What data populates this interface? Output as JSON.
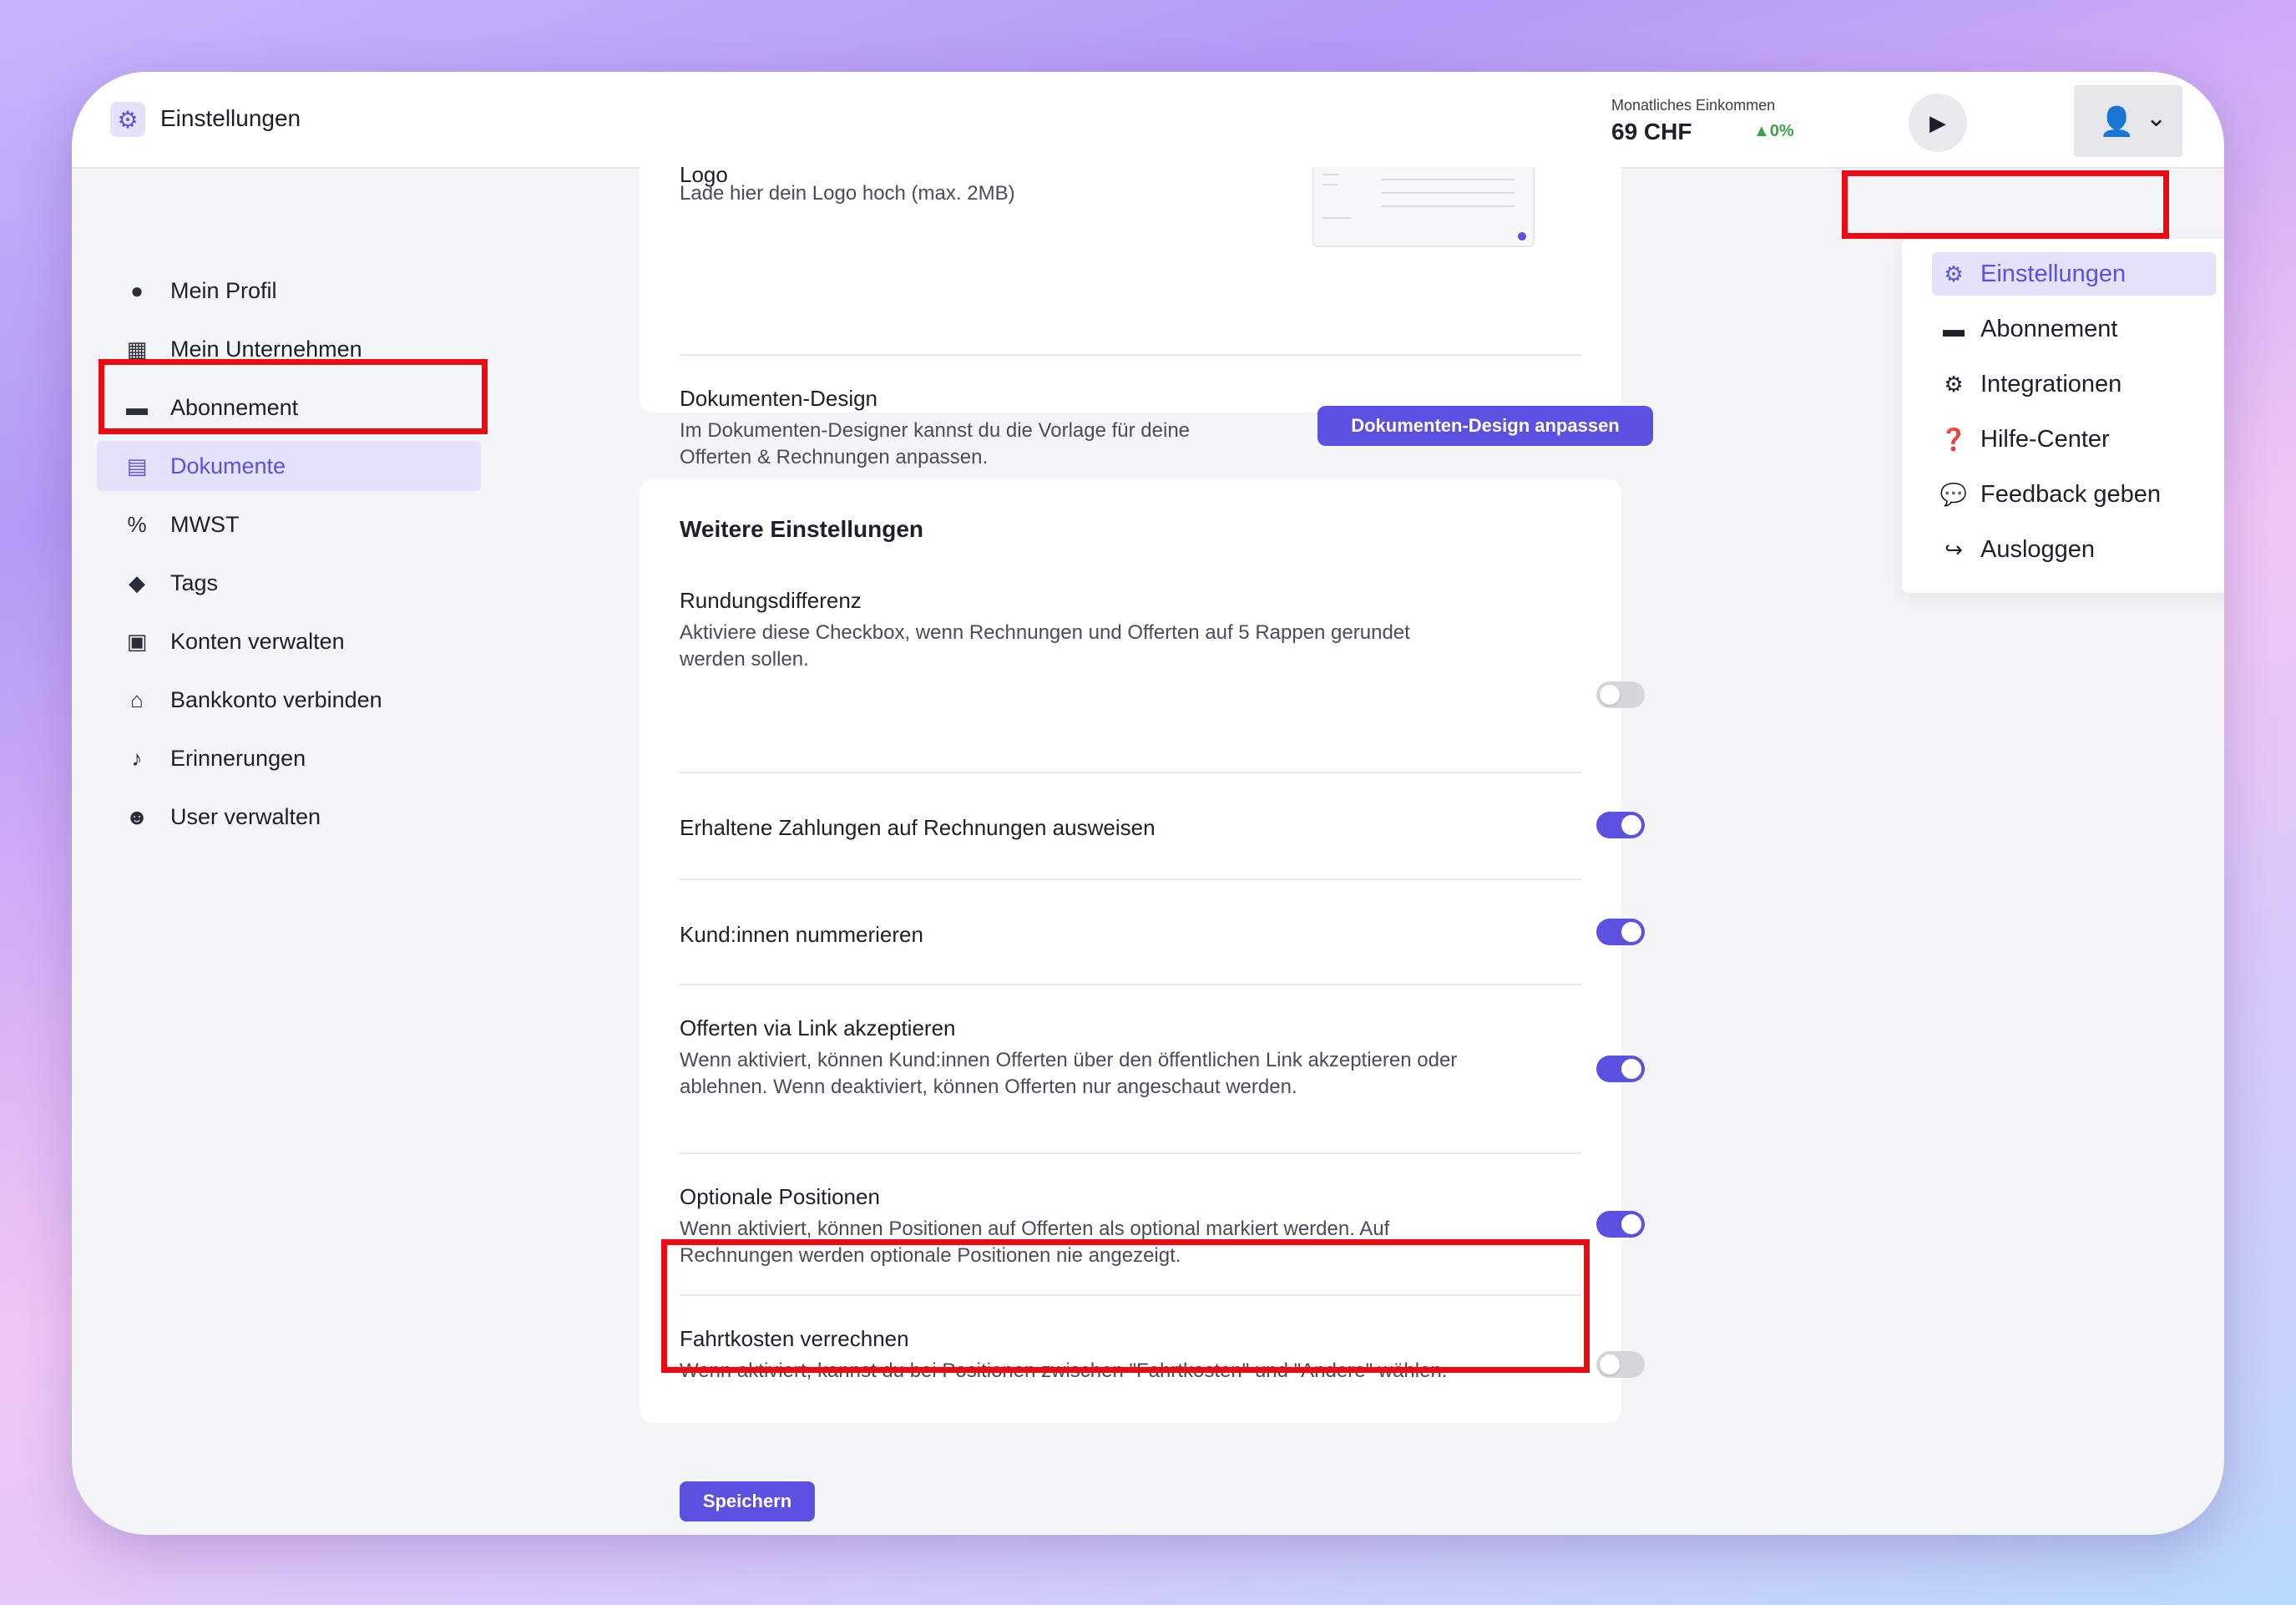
{
  "header": {
    "app_title": "Einstellungen",
    "income_label": "Monatliches Einkommen",
    "income_value": "69 CHF",
    "income_change": "▲0%"
  },
  "sidebar": {
    "items": [
      {
        "label": "Mein Profil",
        "icon": "user-icon"
      },
      {
        "label": "Mein Unternehmen",
        "icon": "building-icon"
      },
      {
        "label": "Abonnement",
        "icon": "credit-card-icon"
      },
      {
        "label": "Dokumente",
        "icon": "document-icon"
      },
      {
        "label": "MWST",
        "icon": "percent-icon"
      },
      {
        "label": "Tags",
        "icon": "tag-icon"
      },
      {
        "label": "Konten verwalten",
        "icon": "calculator-icon"
      },
      {
        "label": "Bankkonto verbinden",
        "icon": "bank-icon"
      },
      {
        "label": "Erinnerungen",
        "icon": "bell-icon"
      },
      {
        "label": "User verwalten",
        "icon": "users-icon"
      }
    ]
  },
  "logo": {
    "title": "Logo",
    "desc": "Lade hier dein Logo hoch (max. 2MB)"
  },
  "document_design": {
    "title": "Dokumenten-Design",
    "desc": "Im Dokumenten-Designer kannst du die Vorlage für deine Offerten & Rechnungen anpassen.",
    "button": "Dokumenten-Design anpassen"
  },
  "settings": {
    "section_title": "Weitere Einstellungen",
    "items": [
      {
        "title": "Rundungsdifferenz",
        "desc": "Aktiviere diese Checkbox, wenn Rechnungen und Offerten auf 5 Rappen gerundet werden sollen.",
        "enabled": false
      },
      {
        "title": "Erhaltene Zahlungen auf Rechnungen ausweisen",
        "desc": "",
        "enabled": true
      },
      {
        "title": "Kund:innen nummerieren",
        "desc": "",
        "enabled": true
      },
      {
        "title": "Offerten via Link akzeptieren",
        "desc": "Wenn aktiviert, können Kund:innen Offerten über den öffentlichen Link akzeptieren oder ablehnen. Wenn deaktiviert, können Offerten nur angeschaut werden.",
        "enabled": true
      },
      {
        "title": "Optionale Positionen",
        "desc": "Wenn aktiviert, können Positionen auf Offerten als optional markiert werden. Auf Rechnungen werden optionale Positionen nie angezeigt.",
        "enabled": true
      },
      {
        "title": "Fahrtkosten verrechnen",
        "desc": "Wenn aktiviert, kannst du bei Positionen zwischen \"Fahrtkosten\" und \"Andere\" wählen.",
        "enabled": false
      }
    ],
    "save_label": "Speichern"
  },
  "user_menu": {
    "items": [
      {
        "label": "Einstellungen",
        "icon": "gear-icon"
      },
      {
        "label": "Abonnement",
        "icon": "credit-card-icon"
      },
      {
        "label": "Integrationen",
        "icon": "gears-icon"
      },
      {
        "label": "Hilfe-Center",
        "icon": "question-icon"
      },
      {
        "label": "Feedback geben",
        "icon": "comments-icon"
      },
      {
        "label": "Ausloggen",
        "icon": "logout-icon"
      }
    ]
  },
  "colors": {
    "accent": "#5b50e0",
    "highlight": "#ec0b12",
    "success": "#3aa34a"
  }
}
